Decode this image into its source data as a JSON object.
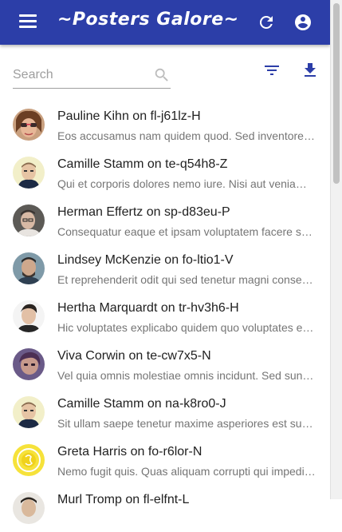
{
  "appbar": {
    "title": "~Posters Galore~",
    "menu_icon": "menu-icon",
    "refresh_icon": "refresh-icon",
    "account_icon": "account-circle-icon",
    "color": "#2c3ea8"
  },
  "toolbar": {
    "search_placeholder": "Search",
    "search_value": "",
    "filter_icon": "filter-icon",
    "export_icon": "download-icon",
    "accent_color": "#2c3ea8"
  },
  "reviews": [
    {
      "title": "Pauline Kihn on fl-j61lz-H",
      "comment": "Eos accusamus nam quidem quod. Sed inventore rerum"
    },
    {
      "title": "Camille Stamm on te-q54h8-Z",
      "comment": "Qui et corporis dolores nemo iure. Nisi aut veniam est"
    },
    {
      "title": "Herman Effertz on sp-d83eu-P",
      "comment": "Consequatur eaque et ipsam voluptatem facere sequi"
    },
    {
      "title": "Lindsey McKenzie on fo-ltio1-V",
      "comment": "Et reprehenderit odit qui sed tenetur magni consectetur"
    },
    {
      "title": "Hertha Marquardt on tr-hv3h6-H",
      "comment": "Hic voluptates explicabo quidem quo voluptates et sunt"
    },
    {
      "title": "Viva Corwin on te-cw7x5-N",
      "comment": "Vel quia omnis molestiae omnis incidunt. Sed sunt quia"
    },
    {
      "title": "Camille Stamm on na-k8ro0-J",
      "comment": "Sit ullam saepe tenetur maxime asperiores est sunt quo"
    },
    {
      "title": "Greta Harris on fo-r6lor-N",
      "comment": "Nemo fugit quis. Quas aliquam corrupti qui impedit sed"
    },
    {
      "title": "Murl Tromp on fl-elfnt-L",
      "comment": ""
    }
  ]
}
